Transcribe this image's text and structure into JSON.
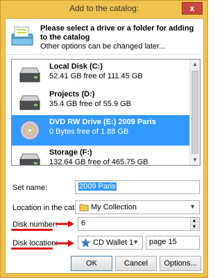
{
  "window": {
    "title": "Add to the catalog:",
    "close_label": "x"
  },
  "header": {
    "bold_text": "Please select a drive or a folder for adding to the catalog",
    "sub_text": "Other options can be changed later..."
  },
  "drives": [
    {
      "name": "Local Disk (C:)",
      "free": "52.41 GB free of 111.45 GB",
      "icon": "hard-drive-icon",
      "selected": false
    },
    {
      "name": "Projects (D:)",
      "free": "35.4 GB free of 55.9 GB",
      "icon": "hard-drive-icon",
      "selected": false
    },
    {
      "name": "DVD RW Drive (E:) 2009 Paris",
      "free": "0 Bytes free of 1.88 GB",
      "icon": "optical-disc-icon",
      "selected": true
    },
    {
      "name": "Storage (F:)",
      "free": "132.64 GB free of 465.75 GB",
      "icon": "hard-drive-icon",
      "selected": false
    }
  ],
  "form": {
    "set_name_label": "Set name:",
    "set_name_value": "2009 Paris",
    "location_label": "Location in the catalog:",
    "location_value": "My Collection",
    "disk_number_label": "Disk number:",
    "disk_number_value": "6",
    "disk_location_label": "Disk location:",
    "disk_location_value": "CD Wallet 1",
    "disk_location_page": "page 15"
  },
  "buttons": {
    "ok": "OK",
    "cancel": "Cancel",
    "options": "Options..."
  },
  "colors": {
    "title_bar": "#f0c34e",
    "selection": "#3399ff",
    "annotation_red": "#e0101a"
  }
}
